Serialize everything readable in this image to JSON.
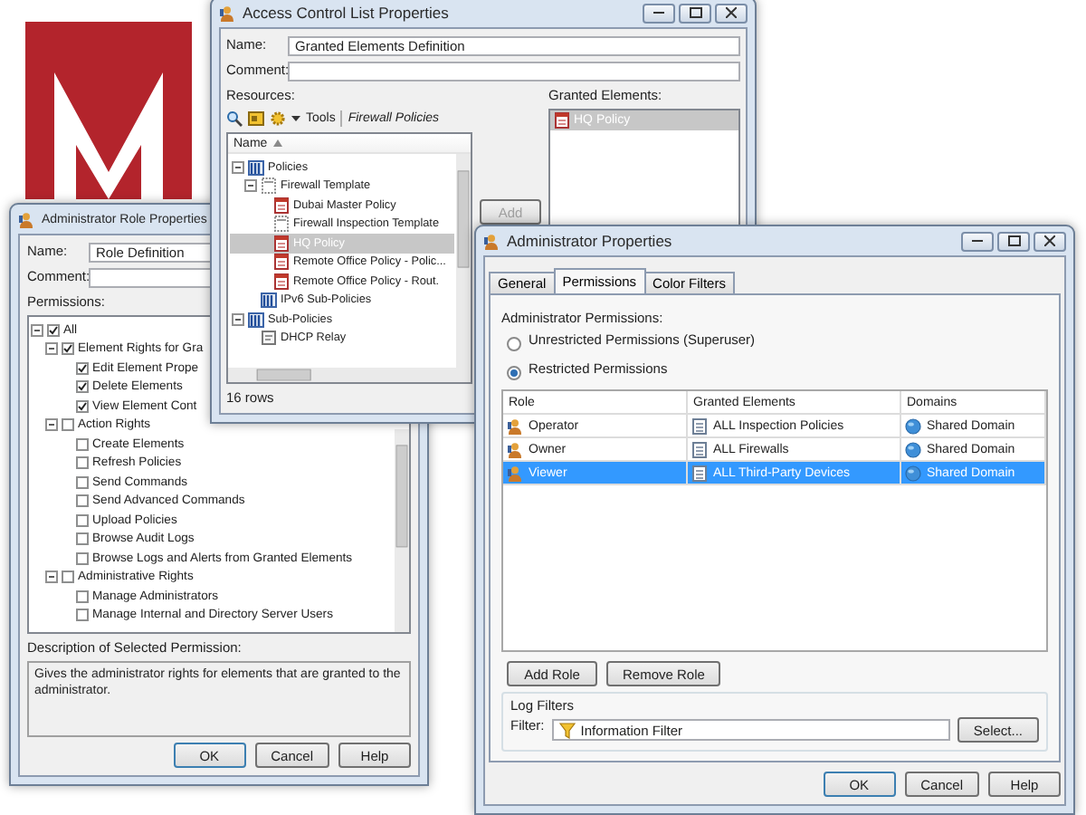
{
  "role_window": {
    "title": "Administrator Role Properties",
    "name_label": "Name:",
    "name_value": "Role Definition",
    "comment_label": "Comment:",
    "permissions_label": "Permissions:",
    "permissions": [
      {
        "label": "All",
        "checked": true,
        "expanded": true,
        "children": [
          {
            "label": "Element Rights for Gra",
            "checked": true,
            "expanded": true,
            "children": [
              {
                "label": "Edit Element Prope",
                "checked": true
              },
              {
                "label": "Delete Elements",
                "checked": true
              },
              {
                "label": "View Element Cont",
                "checked": true
              }
            ]
          },
          {
            "label": "Action Rights",
            "checked": false,
            "expanded": true,
            "children": [
              {
                "label": "Create Elements",
                "checked": false
              },
              {
                "label": "Refresh Policies",
                "checked": false
              },
              {
                "label": "Send Commands",
                "checked": false
              },
              {
                "label": "Send Advanced Commands",
                "checked": false
              },
              {
                "label": "Upload Policies",
                "checked": false
              },
              {
                "label": "Browse Audit Logs",
                "checked": false
              },
              {
                "label": "Browse Logs and Alerts from Granted Elements",
                "checked": false
              }
            ]
          },
          {
            "label": "Administrative Rights",
            "checked": false,
            "expanded": true,
            "children": [
              {
                "label": "Manage Administrators",
                "checked": false
              },
              {
                "label": "Manage Internal and Directory Server Users",
                "checked": false
              }
            ]
          }
        ]
      }
    ],
    "description_label": "Description of Selected Permission:",
    "description": "Gives the administrator rights for elements that are granted to the administrator.",
    "buttons": [
      "OK",
      "Cancel",
      "Help"
    ]
  },
  "acl_window": {
    "title": "Access Control List Properties",
    "name_label": "Name:",
    "name_value": "Granted Elements Definition",
    "comment_label": "Comment:",
    "resources_label": "Resources:",
    "tools_label": "Tools",
    "filter_label": "Firewall Policies",
    "tree_header": "Name",
    "resources": [
      {
        "label": "Policies",
        "kind": "folder",
        "selected": false,
        "expanded": true,
        "children": [
          {
            "label": "Firewall Template",
            "kind": "template",
            "selected": false,
            "expanded": true,
            "children": [
              {
                "label": "Dubai Master Policy",
                "kind": "policy",
                "selected": false
              },
              {
                "label": "Firewall Inspection Template",
                "kind": "template",
                "selected": false
              },
              {
                "label": "HQ Policy",
                "kind": "policy",
                "selected": true
              },
              {
                "label": "Remote Office Policy - Polic...",
                "kind": "policy",
                "selected": false
              },
              {
                "label": "Remote Office Policy - Rout.",
                "kind": "policy",
                "selected": false
              }
            ]
          },
          {
            "label": "IPv6 Sub-Policies",
            "kind": "folder",
            "selected": false
          }
        ]
      },
      {
        "label": "Sub-Policies",
        "kind": "folder",
        "selected": false,
        "expanded": true,
        "children": [
          {
            "label": "DHCP Relay",
            "kind": "relay",
            "selected": false
          }
        ]
      }
    ],
    "row_count": "16 rows",
    "add_button": {
      "label": "Add",
      "disabled": true
    },
    "granted_label": "Granted Elements:",
    "granted": [
      {
        "label": "HQ Policy",
        "selected": true
      }
    ]
  },
  "admin_window": {
    "title": "Administrator Properties",
    "tabs": [
      {
        "label": "General",
        "selected": false
      },
      {
        "label": "Permissions",
        "selected": true
      },
      {
        "label": "Color Filters",
        "selected": false
      }
    ],
    "permissions_label": "Administrator Permissions:",
    "radios": [
      {
        "label": "Unrestricted Permissions (Superuser)",
        "selected": false
      },
      {
        "label": "Restricted Permissions",
        "selected": true
      }
    ],
    "columns": [
      "Role",
      "Granted Elements",
      "Domains"
    ],
    "rows": [
      {
        "role": "Operator",
        "granted": "ALL Inspection Policies",
        "domain": "Shared Domain",
        "selected": false
      },
      {
        "role": "Owner",
        "granted": "ALL Firewalls",
        "domain": "Shared Domain",
        "selected": false
      },
      {
        "role": "Viewer",
        "granted": "ALL Third-Party Devices",
        "domain": "Shared Domain",
        "selected": true
      }
    ],
    "role_buttons": [
      "Add Role",
      "Remove Role"
    ],
    "log_filters_label": "Log Filters",
    "filter_label": "Filter:",
    "filter_value": "Information Filter",
    "select_button": "Select...",
    "buttons": [
      "OK",
      "Cancel",
      "Help"
    ]
  }
}
